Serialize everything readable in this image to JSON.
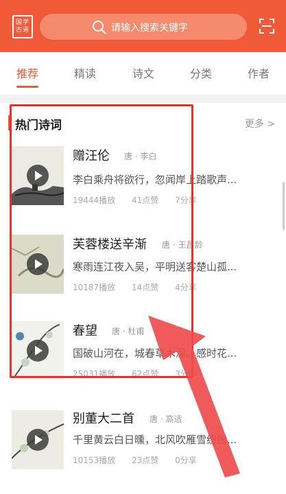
{
  "header": {
    "logo_text": "国学\n古道",
    "search_placeholder": "请输入搜索关键字",
    "icons": {
      "search": "search-icon",
      "scan": "scan-icon"
    }
  },
  "tabs": [
    {
      "label": "推荐",
      "active": true
    },
    {
      "label": "精读"
    },
    {
      "label": "诗文"
    },
    {
      "label": "分类"
    },
    {
      "label": "作者"
    }
  ],
  "section": {
    "title": "热门诗词",
    "more": "更多 >"
  },
  "poems": [
    {
      "title": "赠汪伦",
      "author": "唐 · 李白",
      "excerpt": "李白乘舟将欲行，忽闻岸上踏歌声...",
      "plays": "19444播放",
      "likes": "41点赞",
      "shares": "7分享"
    },
    {
      "title": "芙蓉楼送辛渐",
      "author": "唐 · 王昌龄",
      "excerpt": "寒雨连江夜入吴，平明送客楚山孤...",
      "plays": "10187播放",
      "likes": "14点赞",
      "shares": "4分享"
    },
    {
      "title": "春望",
      "author": "唐 · 杜甫",
      "excerpt": "国破山河在，城春草木深。感时花...",
      "plays": "25031播放",
      "likes": "62点赞",
      "shares": "3分享"
    },
    {
      "title": "别董大二首",
      "author": "唐 · 高适",
      "excerpt": "千里黄云白日曛，北风吹雁雪纷纷...",
      "plays": "10153播放",
      "likes": "23点赞",
      "shares": "0分享"
    }
  ],
  "colors": {
    "brand": "#f05a38",
    "highlight": "#e8302f"
  }
}
